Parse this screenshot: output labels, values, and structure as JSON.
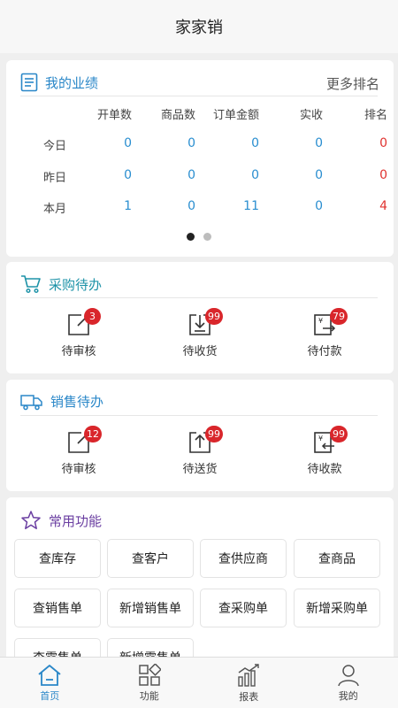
{
  "header": {
    "title": "家家销"
  },
  "performance": {
    "title": "我的业绩",
    "more_label": "更多排名",
    "columns": [
      "开单数",
      "商品数",
      "订单金额",
      "实收",
      "排名"
    ],
    "rows": [
      {
        "label": "今日",
        "values": [
          "0",
          "0",
          "0",
          "0",
          "0"
        ]
      },
      {
        "label": "昨日",
        "values": [
          "0",
          "0",
          "0",
          "0",
          "0"
        ]
      },
      {
        "label": "本月",
        "values": [
          "1",
          "0",
          "11",
          "0",
          "4"
        ]
      }
    ]
  },
  "purchase": {
    "title": "采购待办",
    "items": [
      {
        "label": "待审核",
        "badge": "3"
      },
      {
        "label": "待收货",
        "badge": "99"
      },
      {
        "label": "待付款",
        "badge": "79"
      }
    ]
  },
  "sales": {
    "title": "销售待办",
    "items": [
      {
        "label": "待审核",
        "badge": "12"
      },
      {
        "label": "待送货",
        "badge": "99"
      },
      {
        "label": "待收款",
        "badge": "99"
      }
    ]
  },
  "functions": {
    "title": "常用功能",
    "items": [
      "查库存",
      "查客户",
      "查供应商",
      "查商品",
      "查销售单",
      "新增销售单",
      "查采购单",
      "新增采购单",
      "查零售单",
      "新增零售单"
    ]
  },
  "tabbar": {
    "items": [
      {
        "label": "首页",
        "icon": "home-icon"
      },
      {
        "label": "功能",
        "icon": "grid-icon"
      },
      {
        "label": "报表",
        "icon": "chart-icon"
      },
      {
        "label": "我的",
        "icon": "user-icon"
      }
    ]
  },
  "colors": {
    "accent": "#2a87c8",
    "badge": "#d9262b",
    "rank": "#e0322f"
  }
}
